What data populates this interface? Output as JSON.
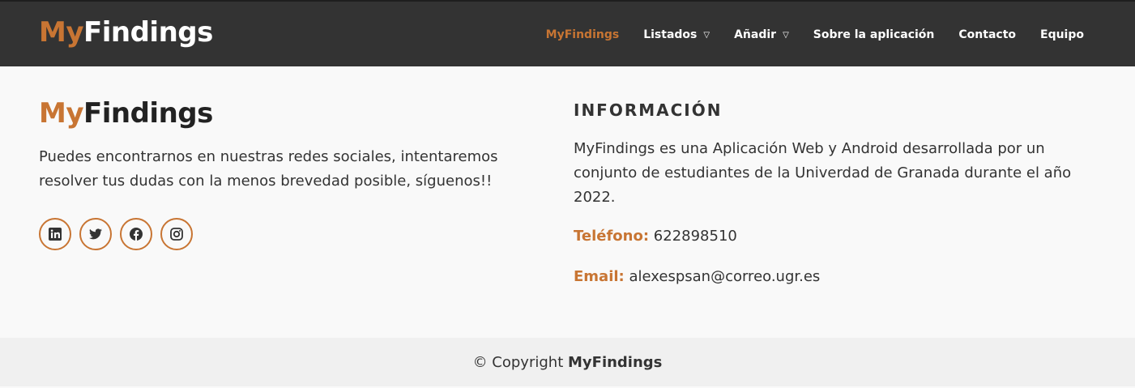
{
  "header": {
    "logo_prefix": "My",
    "logo_suffix": "Findings",
    "nav": [
      {
        "label": "MyFindings"
      },
      {
        "label": "Listados",
        "dropdown": "▽"
      },
      {
        "label": "Añadir",
        "dropdown": "▽"
      },
      {
        "label": "Sobre la aplicación"
      },
      {
        "label": "Contacto"
      },
      {
        "label": "Equipo"
      }
    ]
  },
  "about": {
    "brand_prefix": "My",
    "brand_suffix": "Findings",
    "text": "Puedes encontrarnos en nuestras redes sociales, intentaremos resolver tus dudas con la menos brevedad posible, síguenos!!"
  },
  "info": {
    "title": "INFORMACIÓN",
    "text": "MyFindings es una Aplicación Web y Android desarrollada por un conjunto de estudiantes de la Univerdad de Granada durante el año 2022.",
    "phone_label": "Teléfono:",
    "phone": "622898510",
    "email_label": "Email:",
    "email": "alexespsan@correo.ugr.es"
  },
  "footer": {
    "copyright": "© Copyright",
    "brand": "MyFindings"
  },
  "colors": {
    "accent": "#c87533",
    "header": "#333333"
  }
}
